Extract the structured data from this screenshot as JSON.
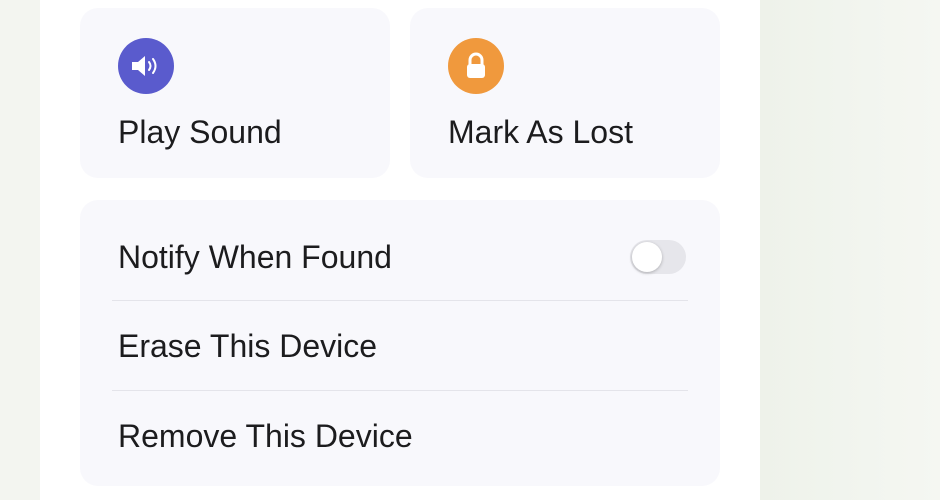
{
  "actions": {
    "play_sound": {
      "label": "Play Sound",
      "icon": "speaker-icon",
      "color": "#5a5bcd"
    },
    "mark_as_lost": {
      "label": "Mark As Lost",
      "icon": "lock-icon",
      "color": "#f0993d"
    }
  },
  "options": {
    "notify_when_found": {
      "label": "Notify When Found",
      "enabled": false
    },
    "erase_device": {
      "label": "Erase This Device"
    },
    "remove_device": {
      "label": "Remove This Device"
    }
  },
  "colors": {
    "card_background": "#f8f8fc",
    "toggle_off": "#e6e6eb",
    "text": "#1c1c1e"
  }
}
